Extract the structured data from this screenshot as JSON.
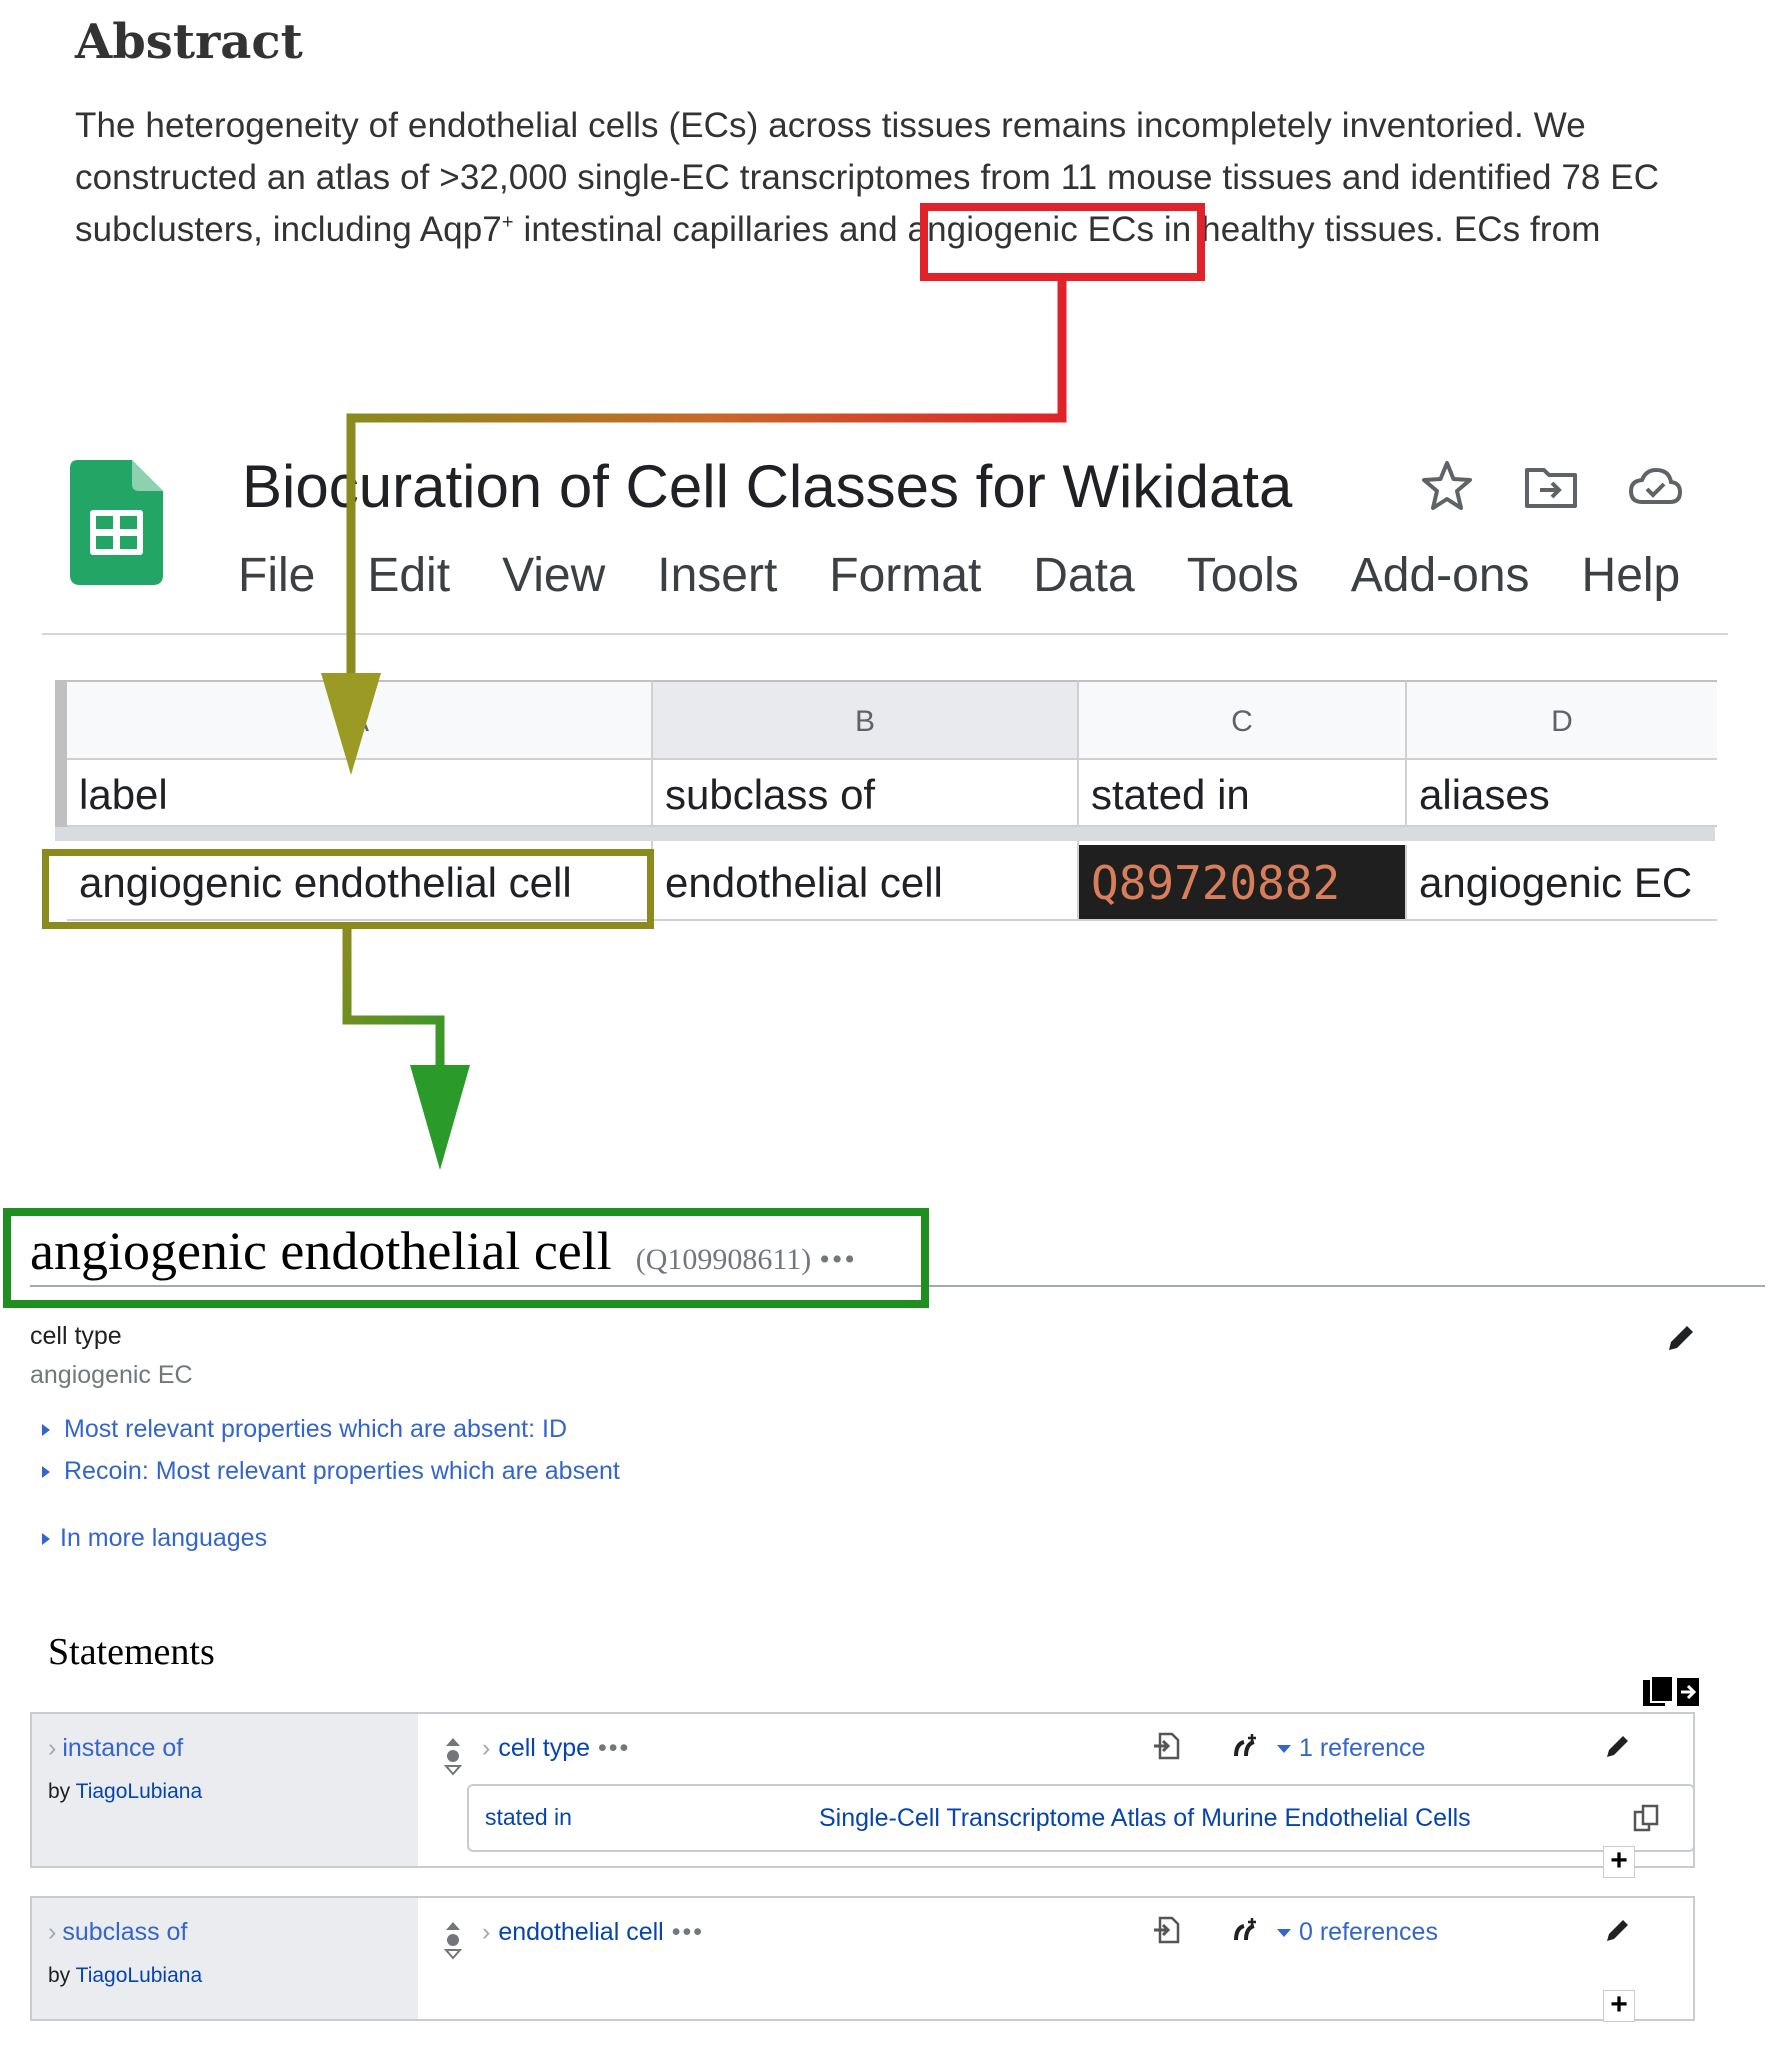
{
  "abstract": {
    "heading": "Abstract",
    "line1": "The heterogeneity of endothelial cells (ECs) across tissues remains incompletely inventoried. We",
    "line2": "constructed an atlas of >32,000 single-EC transcriptomes from 11 mouse tissues and identified 78 EC",
    "line3_pre": "subclusters, including Aqp7",
    "line3_sup": "+",
    "line3_mid": " intestinal capillaries and ",
    "line3_highlight": "angiogenic ECs",
    "line3_post": " in healthy tissues. ECs from"
  },
  "sheets": {
    "title": "Biocuration of Cell Classes for Wikidata",
    "icons": [
      "star-icon",
      "move-to-folder-icon",
      "cloud-saved-icon"
    ],
    "menu": [
      "File",
      "Edit",
      "View",
      "Insert",
      "Format",
      "Data",
      "Tools",
      "Add-ons",
      "Help"
    ],
    "columns": [
      "A",
      "B",
      "C",
      "D"
    ],
    "header_row": [
      "label",
      "subclass of",
      "stated in",
      "aliases"
    ],
    "data_row": [
      "angiogenic endothelial cell",
      "endothelial cell",
      "Q89720882",
      "angiogenic EC"
    ]
  },
  "wikidata": {
    "title": "angiogenic endothelial cell",
    "qid": "(Q109908611)",
    "description": "cell type",
    "alias": "angiogenic EC",
    "links": [
      "Most relevant properties which are absent: ID",
      "Recoin: Most relevant properties which are absent"
    ],
    "more_languages": "In more languages",
    "statements_heading": "Statements",
    "statements": [
      {
        "property": "instance of",
        "by_prefix": "by ",
        "by_user": "TiagoLubiana",
        "value": "cell type",
        "references": "1 reference",
        "ref_property": "stated in",
        "ref_value": "Single-Cell Transcriptome Atlas of Murine Endothelial Cells"
      },
      {
        "property": "subclass of",
        "by_prefix": "by ",
        "by_user": "TiagoLubiana",
        "value": "endothelial cell",
        "references": "0 references"
      }
    ]
  },
  "colors": {
    "highlight_red": "#e0232a",
    "highlight_olive": "#8a8a1e",
    "highlight_green": "#1f8f1f",
    "sheets_green": "#23a566",
    "link_blue": "#3366cc"
  }
}
